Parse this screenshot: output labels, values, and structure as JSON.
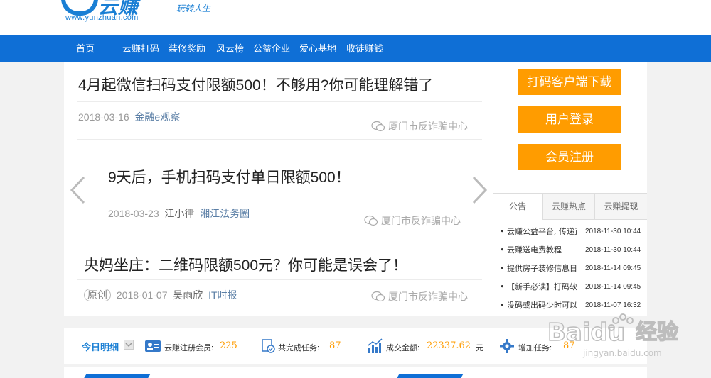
{
  "header": {
    "logo_text": "云赚",
    "logo_url": "www.yunzhuan.com",
    "slogan": "玩转人生"
  },
  "nav": [
    "首页",
    "云赚打码",
    "装修奖励",
    "风云榜",
    "公益企业",
    "爱心基地",
    "收徒赚钱"
  ],
  "carousel": {
    "slides": [
      {
        "title": "4月起微信扫码支付限额500！不够用?你可能理解错了",
        "date": "2018-03-16",
        "author": "",
        "source": "金融e观察",
        "badge": "",
        "watermark": "厦门市反诈骗中心"
      },
      {
        "title": "9天后，手机扫码支付单日限额500！",
        "date": "2018-03-23",
        "author": "江小律",
        "source": "湘江法务圈",
        "badge": "",
        "watermark": "厦门市反诈骗中心"
      },
      {
        "title": "央妈坐庄：二维码限额500元？你可能是误会了！",
        "date": "2018-01-07",
        "author": "吴雨欣",
        "source": "IT时报",
        "badge": "原创",
        "watermark": "厦门市反诈骗中心"
      }
    ]
  },
  "buttons": {
    "download": "打码客户端下载",
    "login": "用户登录",
    "register": "会员注册"
  },
  "tabs": [
    "公告",
    "云赚热点",
    "云赚提现"
  ],
  "notices": [
    {
      "title": "• 云赚公益平台, 传递正能量",
      "date": "2018-11-30 10:44"
    },
    {
      "title": "• 云赚送电费教程",
      "date": "2018-11-30 10:44"
    },
    {
      "title": "• 提供房子装修信息日赚",
      "date": "2018-11-14 09:45"
    },
    {
      "title": "• 【新手必读】打码软件",
      "date": "2018-11-14 09:45"
    },
    {
      "title": "• 没码或出码少时可以",
      "date": "2018-11-07 16:32"
    }
  ],
  "stats": {
    "today_label": "今日明细",
    "members_label": "云赚注册会员:",
    "members_value": "225",
    "tasks_label": "共完成任务:",
    "tasks_value": "87",
    "amount_label": "成交金额:",
    "amount_value": "22337.62",
    "amount_unit": "元",
    "added_label": "增加任务:",
    "added_value": "87"
  },
  "watermark": {
    "brand": "Baidu",
    "cn": "经验",
    "url": "jingyan.baidu.com"
  },
  "colors": {
    "nav_blue": "#0f6fd6",
    "orange": "#ff9c00",
    "text_blue": "#1a7fd4"
  }
}
